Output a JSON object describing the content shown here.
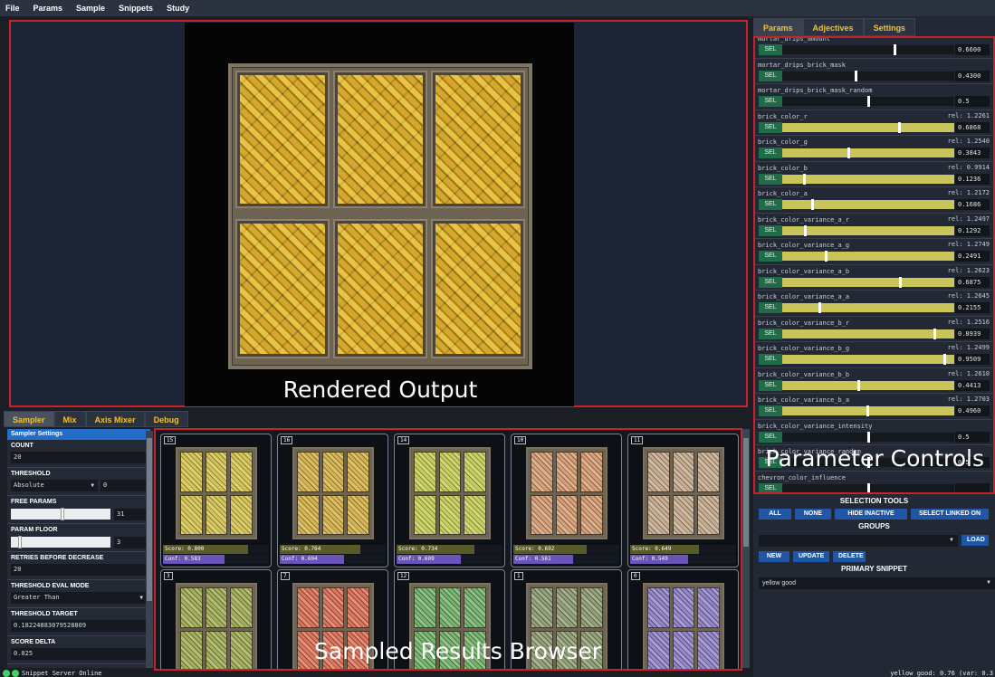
{
  "menu": [
    "File",
    "Params",
    "Sample",
    "Snippets",
    "Study"
  ],
  "render": {
    "label": "Rendered Output"
  },
  "right_tabs": [
    "Params",
    "Adjectives",
    "Settings"
  ],
  "params": [
    {
      "name": "mortar_drips_amount",
      "rel": "",
      "value": "0.6600",
      "pos": 0.66,
      "fill": false
    },
    {
      "name": "mortar_drips_brick_mask",
      "rel": "",
      "value": "0.4300",
      "pos": 0.43,
      "fill": false
    },
    {
      "name": "mortar_drips_brick_mask_random",
      "rel": "",
      "value": "0.5",
      "pos": 0.5,
      "fill": false
    },
    {
      "name": "brick_color_r",
      "rel": "rel: 1.2261",
      "value": "0.6868",
      "pos": 0.6868,
      "fill": true
    },
    {
      "name": "brick_color_g",
      "rel": "rel: 1.2540",
      "value": "0.3843",
      "pos": 0.3843,
      "fill": true
    },
    {
      "name": "brick_color_b",
      "rel": "rel: 0.9914",
      "value": "0.1236",
      "pos": 0.1236,
      "fill": true
    },
    {
      "name": "brick_color_a",
      "rel": "rel: 1.2172",
      "value": "0.1686",
      "pos": 0.1686,
      "fill": true
    },
    {
      "name": "brick_color_variance_a_r",
      "rel": "rel: 1.2497",
      "value": "0.1292",
      "pos": 0.1292,
      "fill": true
    },
    {
      "name": "brick_color_variance_a_g",
      "rel": "rel: 1.2749",
      "value": "0.2491",
      "pos": 0.2491,
      "fill": true
    },
    {
      "name": "brick_color_variance_a_b",
      "rel": "rel: 1.2623",
      "value": "0.6875",
      "pos": 0.6875,
      "fill": true
    },
    {
      "name": "brick_color_variance_a_a",
      "rel": "rel: 1.2645",
      "value": "0.2155",
      "pos": 0.2155,
      "fill": true
    },
    {
      "name": "brick_color_variance_b_r",
      "rel": "rel: 1.2516",
      "value": "0.8939",
      "pos": 0.8939,
      "fill": true
    },
    {
      "name": "brick_color_variance_b_g",
      "rel": "rel: 1.2499",
      "value": "0.9509",
      "pos": 0.9509,
      "fill": true
    },
    {
      "name": "brick_color_variance_b_b",
      "rel": "rel: 1.2610",
      "value": "0.4413",
      "pos": 0.4413,
      "fill": true
    },
    {
      "name": "brick_color_variance_b_a",
      "rel": "rel: 1.2703",
      "value": "0.4960",
      "pos": 0.496,
      "fill": true
    },
    {
      "name": "brick_color_variance_intensity",
      "rel": "",
      "value": "0.5",
      "pos": 0.5,
      "fill": false
    },
    {
      "name": "brick_color_variance_random",
      "rel": "",
      "value": "0.5",
      "pos": 0.5,
      "fill": false
    },
    {
      "name": "chevron_color_influence",
      "rel": "",
      "value": "",
      "pos": 0.5,
      "fill": false
    }
  ],
  "sel_label": "SEL",
  "param_overlay": "Parameter Controls",
  "selection": {
    "title": "SELECTION TOOLS",
    "buttons": [
      "ALL",
      "NONE",
      "HIDE INACTIVE",
      "SELECT LINKED ON"
    ],
    "groups_title": "GROUPS",
    "groups_value": "",
    "load": "LOAD",
    "group_buttons": [
      "NEW",
      "UPDATE",
      "DELETE"
    ],
    "primary_title": "PRIMARY SNIPPET",
    "primary_value": "yellow good"
  },
  "status_right": "yellow good: 0.76 (var: 0.3",
  "bottom_tabs": [
    "Sampler",
    "Mix",
    "Axis Mixer",
    "Debug"
  ],
  "sampler": {
    "header": "Sampler Settings",
    "count_label": "COUNT",
    "count": "20",
    "threshold_label": "THRESHOLD",
    "threshold_mode": "Absolute",
    "threshold_val": "0",
    "free_params_label": "FREE PARAMS",
    "free_params": "31",
    "free_params_frac": 0.52,
    "param_floor_label": "PARAM FLOOR",
    "param_floor": "3",
    "param_floor_frac": 0.08,
    "retries_label": "RETRIES BEFORE DECREASE",
    "retries": "20",
    "eval_mode_label": "THRESHOLD EVAL MODE",
    "eval_mode": "Greater Than",
    "target_label": "THRESHOLD TARGET",
    "target": "0.18224883079528809",
    "delta_label": "SCORE DELTA",
    "delta": "0.025"
  },
  "results": [
    {
      "id": "15",
      "score": "Score: 0.800",
      "conf": "Conf: 0.583",
      "score_v": 0.8,
      "conf_v": 0.583,
      "color": "#c9b533"
    },
    {
      "id": "16",
      "score": "Score: 0.764",
      "conf": "Conf: 0.604",
      "score_v": 0.764,
      "conf_v": 0.604,
      "color": "#c9a22a"
    },
    {
      "id": "14",
      "score": "Score: 0.734",
      "conf": "Conf: 0.609",
      "score_v": 0.734,
      "conf_v": 0.609,
      "color": "#b9c23a"
    },
    {
      "id": "10",
      "score": "Score: 0.692",
      "conf": "Conf: 0.561",
      "score_v": 0.692,
      "conf_v": 0.561,
      "color": "#c98a5a"
    },
    {
      "id": "11",
      "score": "Score: 0.649",
      "conf": "Conf: 0.549",
      "score_v": 0.649,
      "conf_v": 0.549,
      "color": "#b89a78"
    },
    {
      "id": "3",
      "score": "",
      "conf": "",
      "score_v": 0,
      "conf_v": 0,
      "color": "#8e9a3a"
    },
    {
      "id": "7",
      "score": "",
      "conf": "",
      "score_v": 0,
      "conf_v": 0,
      "color": "#d0583a"
    },
    {
      "id": "12",
      "score": "",
      "conf": "",
      "score_v": 0,
      "conf_v": 0,
      "color": "#5aa050"
    },
    {
      "id": "1",
      "score": "",
      "conf": "",
      "score_v": 0,
      "conf_v": 0,
      "color": "#7a8a5a"
    },
    {
      "id": "0",
      "score": "",
      "conf": "",
      "score_v": 0,
      "conf_v": 0,
      "color": "#7a6ab8"
    }
  ],
  "results_overlay": "Sampled Results Browser",
  "status": {
    "text": "Snippet Server Online",
    "dot_color": "#3fd36a"
  }
}
